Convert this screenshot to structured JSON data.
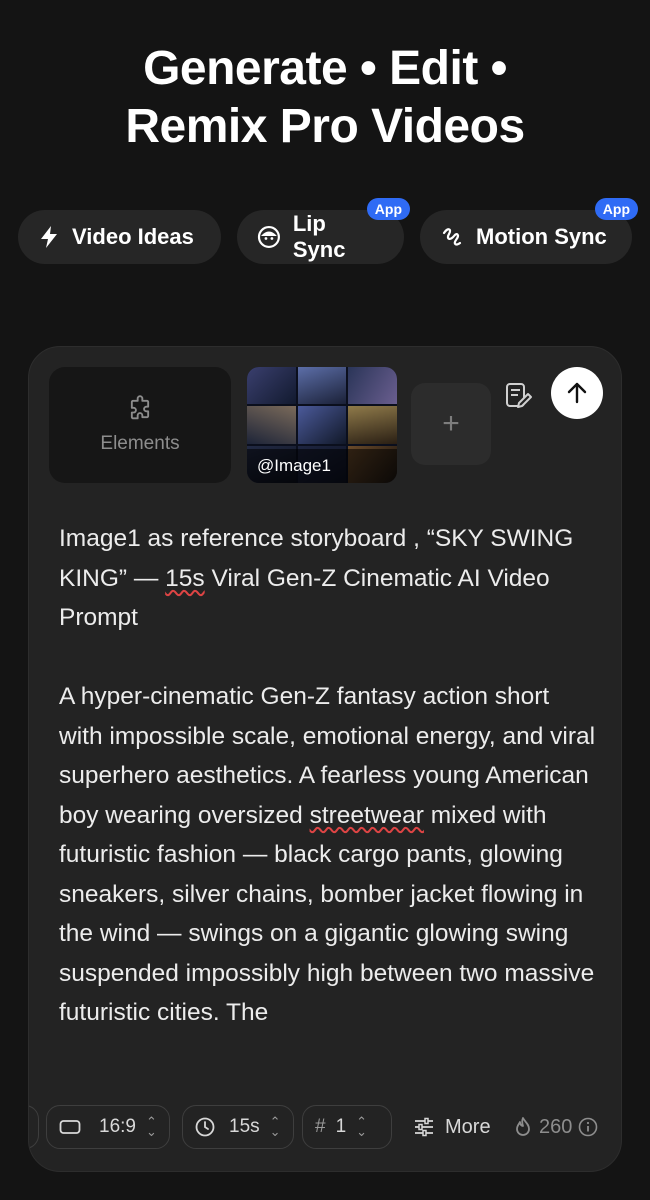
{
  "hero": {
    "line1": "Generate • Edit •",
    "line2": "Remix Pro Videos"
  },
  "chips": [
    {
      "label": "Video Ideas",
      "icon": "lightning-icon"
    },
    {
      "label": "Lip Sync",
      "icon": "face-icon",
      "badge": "App"
    },
    {
      "label": "Motion Sync",
      "icon": "motion-icon",
      "badge": "App"
    }
  ],
  "composer": {
    "elements_label": "Elements",
    "thumbnail_label": "@Image1",
    "add_label": "+",
    "prompt_p1_a": "Image1 as reference storyboard , “SKY SWING KING” — ",
    "prompt_p1_flag": "15s",
    "prompt_p1_b": " Viral Gen-Z Cinematic AI Video Prompt",
    "prompt_p2_a": "A hyper-cinematic Gen-Z fantasy action short with impossible scale, emotional energy, and viral superhero aesthetics. A fearless young American boy wearing oversized ",
    "prompt_p2_flag": "streetwear",
    "prompt_p2_b": " mixed with futuristic fashion — black cargo pants, glowing sneakers, silver chains, bomber jacket flowing in the wind — swings on a gigantic glowing swing suspended impossibly high between two massive futuristic cities. The"
  },
  "toolbar": {
    "aspect": "16:9",
    "duration": "15s",
    "count_symbol": "#",
    "count": "1",
    "more_label": "More",
    "credits": "260"
  }
}
